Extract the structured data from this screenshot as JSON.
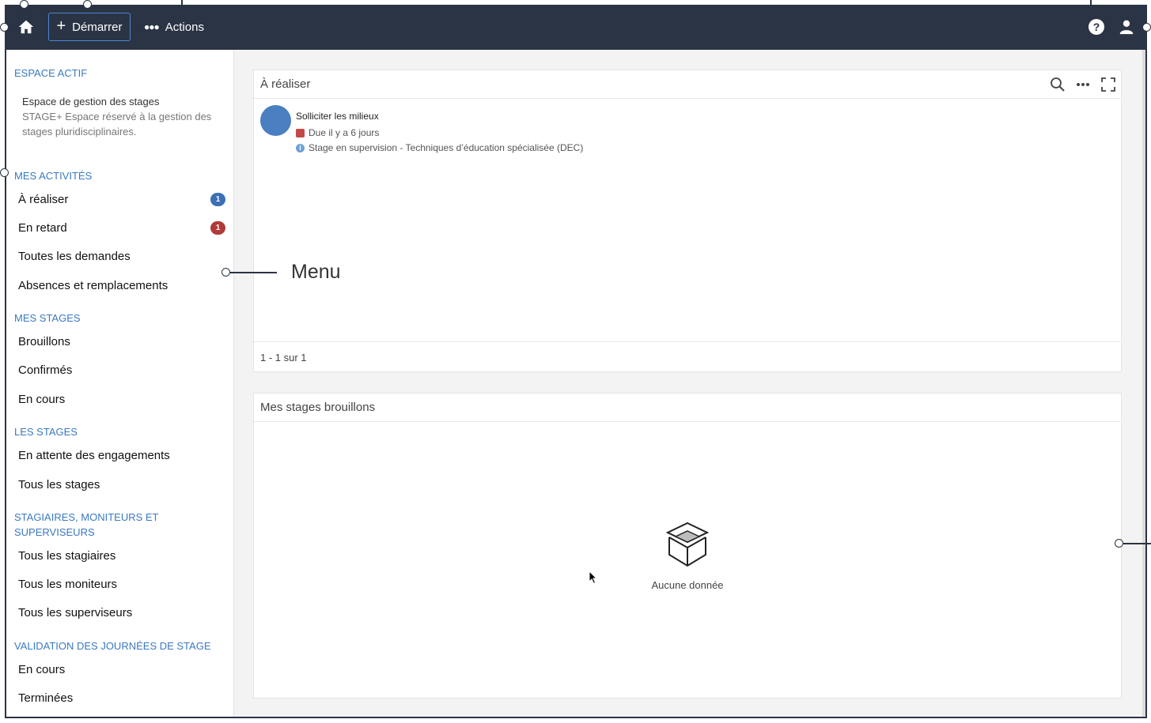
{
  "topbar": {
    "start_label": "Démarrer",
    "actions_label": "Actions",
    "help_glyph": "?",
    "icons": [
      "home-icon",
      "plus-icon",
      "ellipsis-icon",
      "help-icon",
      "user-icon"
    ]
  },
  "sidebar": {
    "active_space_title": "ESPACE ACTIF",
    "space_name": "Espace de gestion des stages",
    "space_desc": "STAGE+ Espace réservé à la gestion des stages pluridisciplinaires.",
    "activities_title": "MES ACTIVITÉS",
    "activities": [
      {
        "label": "À réaliser",
        "badge": "1"
      },
      {
        "label": "En retard",
        "badge": "1"
      },
      {
        "label": "Toutes les demandes"
      },
      {
        "label": "Absences et remplacements"
      }
    ],
    "my_stages_title": "MES STAGES",
    "my_stages": [
      {
        "label": "Brouillons"
      },
      {
        "label": "Confirmés"
      },
      {
        "label": "En cours"
      }
    ],
    "stages_title": "LES STAGES",
    "stages": [
      {
        "label": "En attente des engagements"
      },
      {
        "label": "Tous les stages"
      }
    ],
    "people_title_line1": "STAGIAIRES, MONITEURS ET",
    "people_title_line2": "SUPERVISEURS",
    "people": [
      {
        "label": "Tous les stagiaires"
      },
      {
        "label": "Tous les moniteurs"
      },
      {
        "label": "Tous les superviseurs"
      }
    ],
    "validation_title": "VALIDATION DES JOURNÉES DE STAGE",
    "validation": [
      {
        "label": "En cours"
      },
      {
        "label": "Terminées"
      }
    ]
  },
  "todo_panel": {
    "title": "À réaliser",
    "task": {
      "title": "Solliciter les milieux",
      "due": "Due il y a 6 jours",
      "info": "Stage en supervision - Techniques d’éducation spécialisée (DEC)"
    },
    "pagination": "1 - 1 sur 1"
  },
  "drafts_panel": {
    "title": "Mes stages brouillons",
    "empty_text": "Aucune donnée"
  },
  "annotation": {
    "menu_label": "Menu"
  },
  "colors": {
    "topbar": "#2a3444",
    "accent": "#3a79c0",
    "badge_blue": "#3b6fb6",
    "badge_red": "#b03a3a",
    "avatar": "#4a7fc1"
  }
}
